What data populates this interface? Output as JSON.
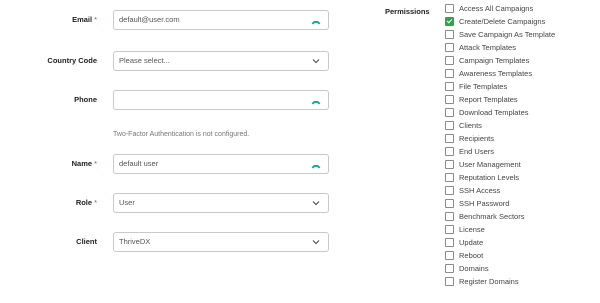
{
  "form": {
    "email": {
      "label": "Email",
      "required": "*",
      "value": "default@user.com"
    },
    "country": {
      "label": "Country Code",
      "value": "Please select..."
    },
    "phone": {
      "label": "Phone",
      "value": ""
    },
    "two_factor_note": "Two-Factor Authentication is not configured.",
    "name": {
      "label": "Name",
      "required": "*",
      "value": "default user"
    },
    "role": {
      "label": "Role",
      "required": "*",
      "value": "User"
    },
    "client": {
      "label": "Client",
      "value": "ThriveDX"
    }
  },
  "permissions": {
    "label": "Permissions",
    "items": [
      {
        "label": "Access All Campaigns",
        "checked": false
      },
      {
        "label": "Create/Delete Campaigns",
        "checked": true
      },
      {
        "label": "Save Campaign As Template",
        "checked": false
      },
      {
        "label": "Attack Templates",
        "checked": false
      },
      {
        "label": "Campaign Templates",
        "checked": false
      },
      {
        "label": "Awareness Templates",
        "checked": false
      },
      {
        "label": "File Templates",
        "checked": false
      },
      {
        "label": "Report Templates",
        "checked": false
      },
      {
        "label": "Download Templates",
        "checked": false
      },
      {
        "label": "Clients",
        "checked": false
      },
      {
        "label": "Recipients",
        "checked": false
      },
      {
        "label": "End Users",
        "checked": false
      },
      {
        "label": "User Management",
        "checked": false
      },
      {
        "label": "Reputation Levels",
        "checked": false
      },
      {
        "label": "SSH Access",
        "checked": false
      },
      {
        "label": "SSH Password",
        "checked": false
      },
      {
        "label": "Benchmark Sectors",
        "checked": false
      },
      {
        "label": "License",
        "checked": false
      },
      {
        "label": "Update",
        "checked": false
      },
      {
        "label": "Reboot",
        "checked": false
      },
      {
        "label": "Domains",
        "checked": false
      },
      {
        "label": "Register Domains",
        "checked": false
      }
    ]
  },
  "colors": {
    "accent": "#1aa39a",
    "required": "#e03030",
    "checked": "#2ea44f"
  }
}
